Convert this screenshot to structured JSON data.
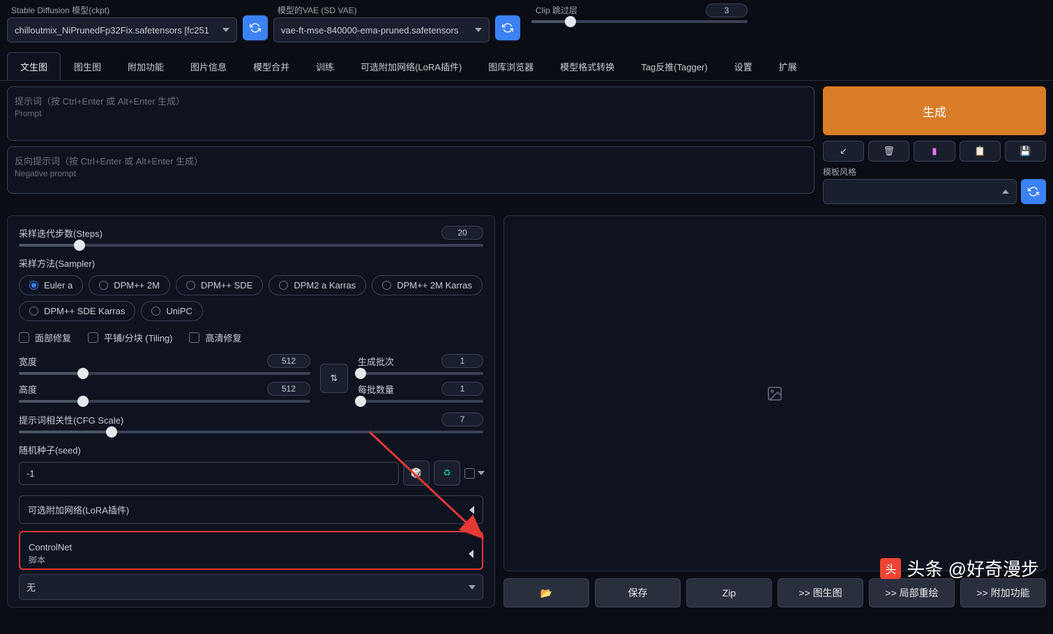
{
  "topbar": {
    "ckpt_label": "Stable Diffusion 模型(ckpt)",
    "ckpt_value": "chilloutmix_NiPrunedFp32Fix.safetensors [fc251",
    "vae_label": "模型的VAE (SD VAE)",
    "vae_value": "vae-ft-mse-840000-ema-pruned.safetensors",
    "clipskip_label": "Clip 跳过层",
    "clipskip_value": "3"
  },
  "tabs": [
    "文生图",
    "图生图",
    "附加功能",
    "图片信息",
    "模型合并",
    "训练",
    "可选附加网络(LoRA插件)",
    "图库浏览器",
    "模型格式转换",
    "Tag反推(Tagger)",
    "设置",
    "扩展"
  ],
  "prompt": {
    "placeholder1": "提示词（按 Ctrl+Enter 或 Alt+Enter 生成）",
    "placeholder2": "Prompt",
    "neg_placeholder1": "反向提示词（按 Ctrl+Enter 或 Alt+Enter 生成）",
    "neg_placeholder2": "Negative prompt"
  },
  "generate_label": "生成",
  "style_label": "模板风格",
  "params": {
    "steps_label": "采样迭代步数(Steps)",
    "steps_value": "20",
    "sampler_label": "采样方法(Sampler)",
    "samplers": [
      "Euler a",
      "DPM++ 2M",
      "DPM++ SDE",
      "DPM2 a Karras",
      "DPM++ 2M Karras",
      "DPM++ SDE Karras",
      "UniPC"
    ],
    "face_restore": "面部修复",
    "tiling": "平铺/分块 (Tiling)",
    "hires": "高清修复",
    "width_label": "宽度",
    "width_value": "512",
    "height_label": "高度",
    "height_value": "512",
    "batch_count_label": "生成批次",
    "batch_count_value": "1",
    "batch_size_label": "每批数量",
    "batch_size_value": "1",
    "cfg_label": "提示词相关性(CFG Scale)",
    "cfg_value": "7",
    "seed_label": "随机种子(seed)",
    "seed_value": "-1",
    "lora_label": "可选附加网络(LoRA插件)",
    "controlnet_label": "ControlNet",
    "script_label": "脚本",
    "script_value": "无"
  },
  "bottom_buttons": {
    "save": "保存",
    "zip": "Zip",
    "img2img": ">> 图生图",
    "inpaint": ">> 局部重绘",
    "extras": ">> 附加功能"
  },
  "watermark": "头条 @好奇漫步"
}
